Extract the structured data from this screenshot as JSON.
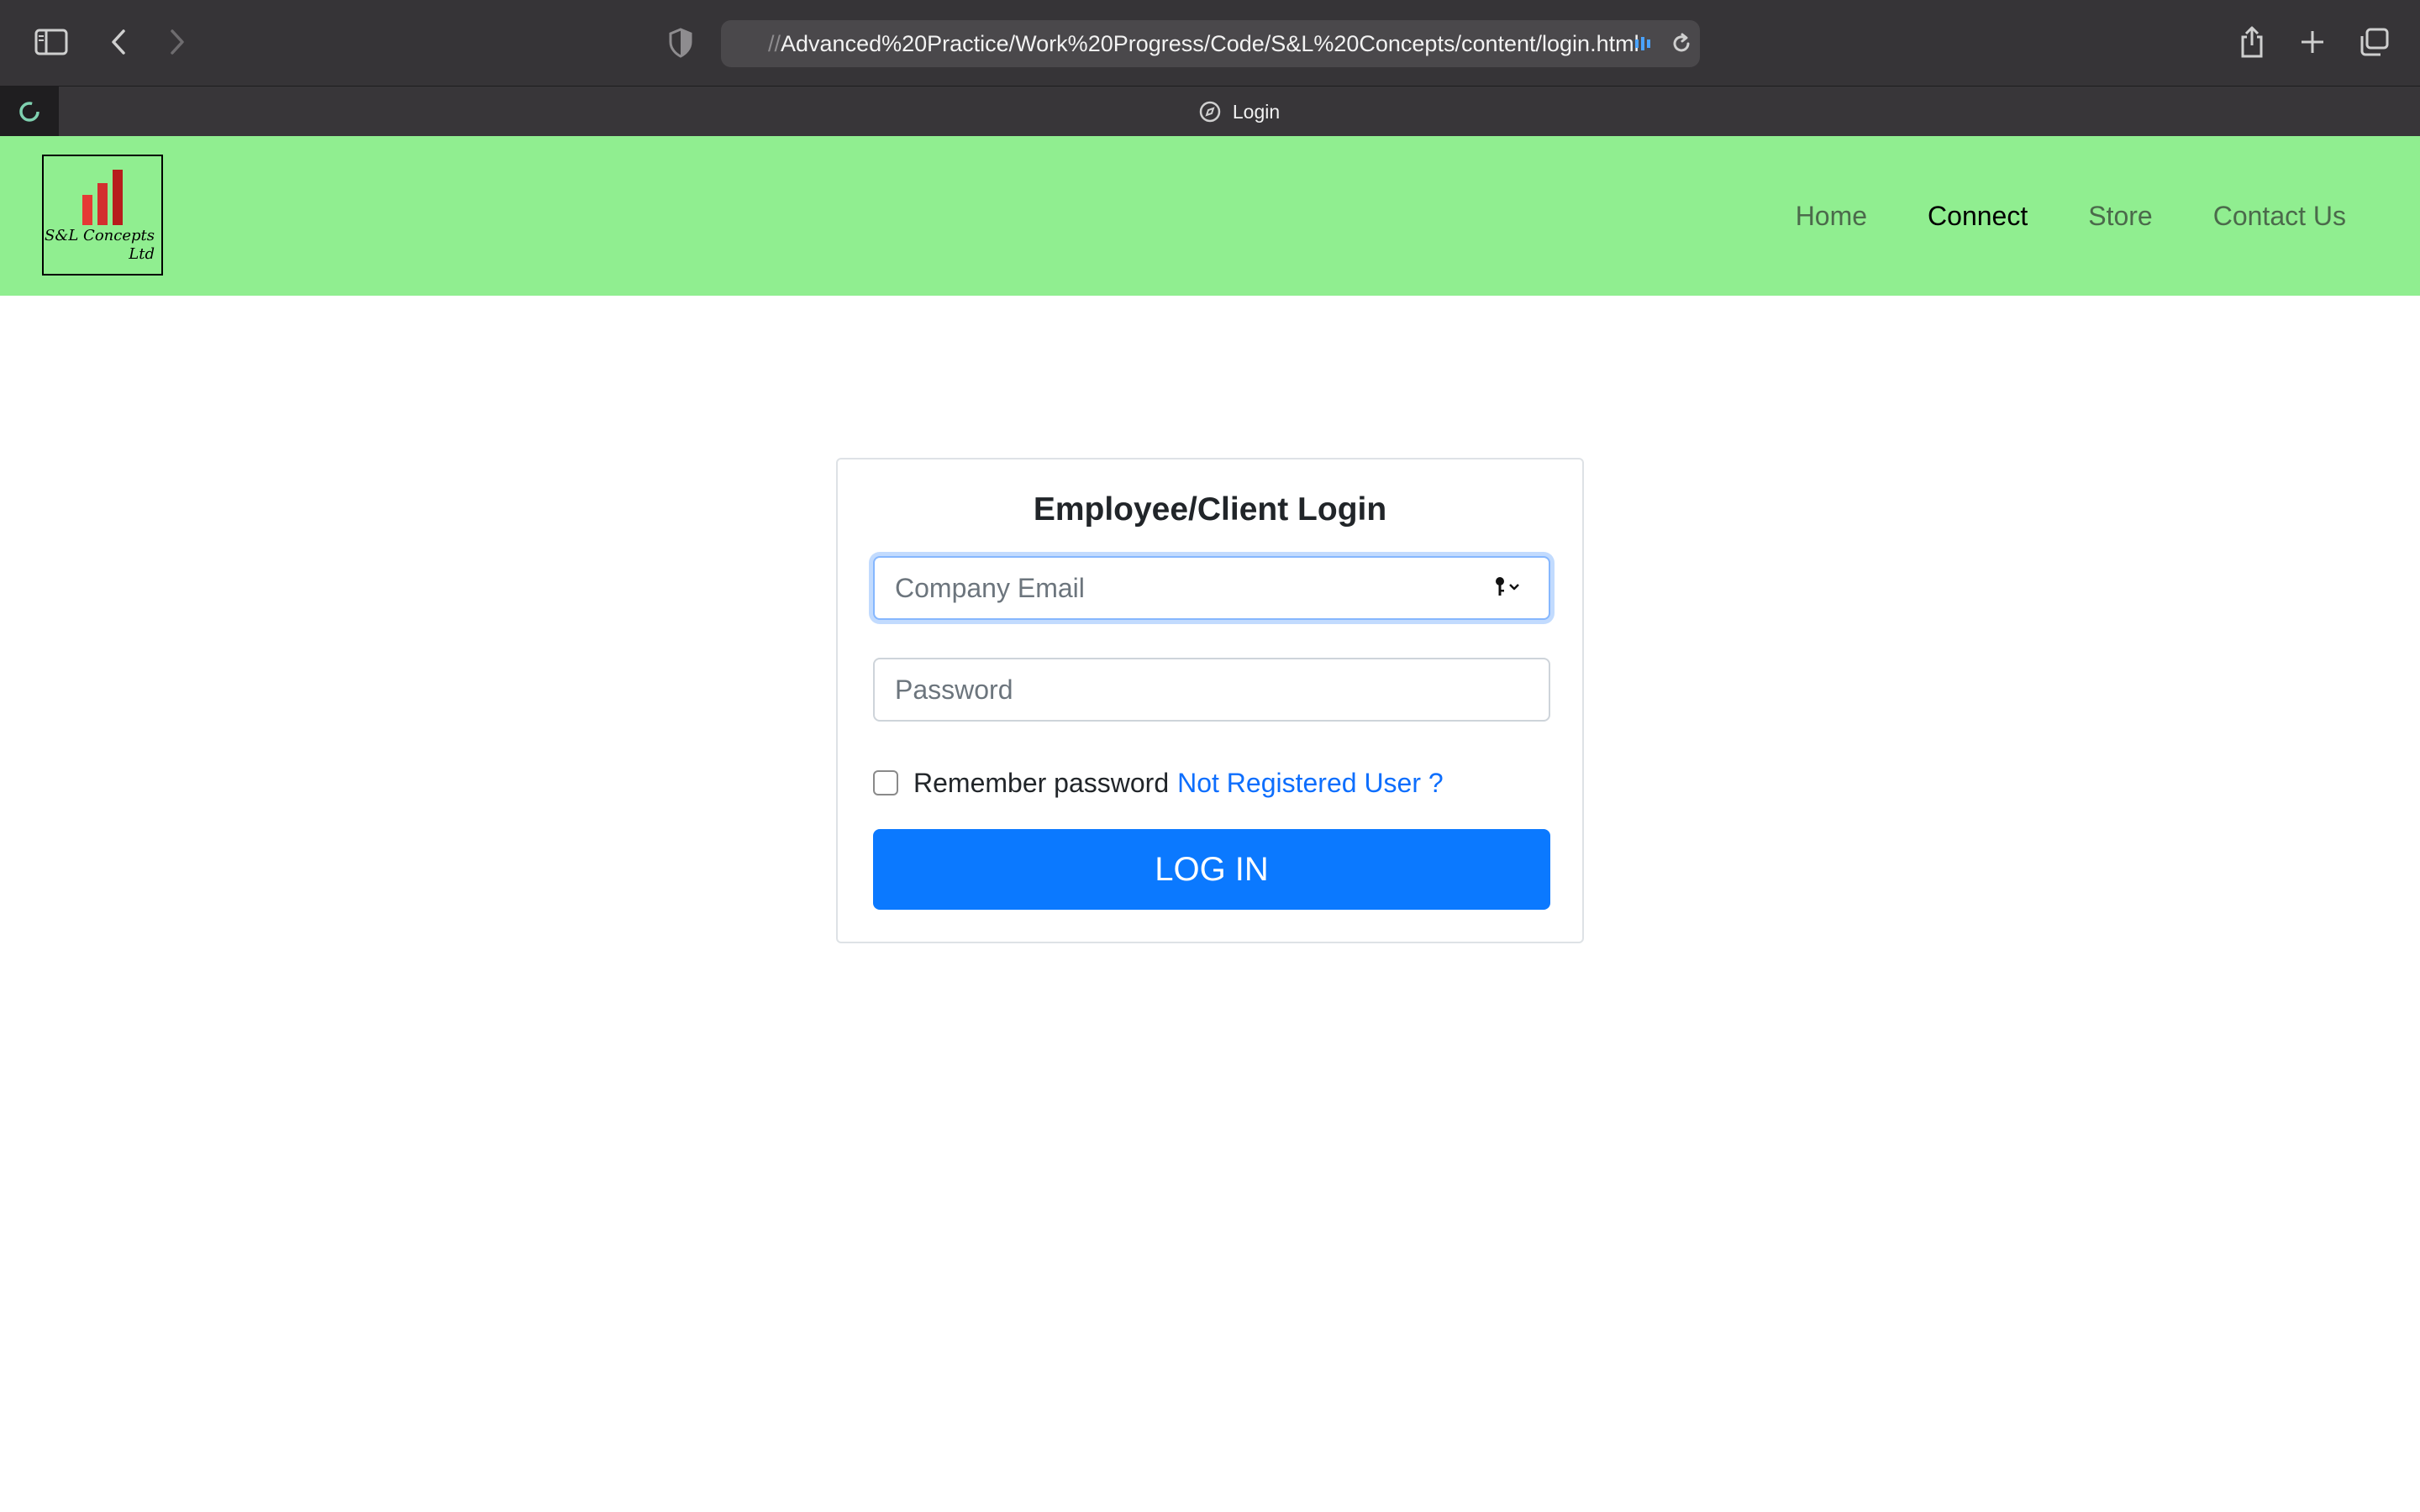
{
  "browser": {
    "url_prefix": "//",
    "url": "Advanced%20Practice/Work%20Progress/Code/S&L%20Concepts/content/login.html",
    "tab_title": "Login",
    "icons": {
      "sidebar": "sidebar-icon",
      "back": "chevron-left-icon",
      "forward": "chevron-right-icon",
      "privacy": "shield-icon",
      "reload": "reload-icon",
      "share": "share-icon",
      "new_tab": "plus-icon",
      "tab_overview": "tabs-overview-icon"
    }
  },
  "site": {
    "logo_text_line1": "S&L Concepts",
    "logo_text_line2": "Ltd",
    "nav": [
      {
        "label": "Home",
        "active": false
      },
      {
        "label": "Connect",
        "active": true
      },
      {
        "label": "Store",
        "active": false
      },
      {
        "label": "Contact Us",
        "active": false
      }
    ],
    "colors": {
      "nav_bg": "#90ee90",
      "logo_bar_light": "#e53935",
      "logo_bar_dark": "#b71c1c"
    }
  },
  "login": {
    "title": "Employee/Client Login",
    "email_placeholder": "Company Email",
    "email_value": "",
    "password_placeholder": "Password",
    "password_value": "",
    "remember_label": "Remember password",
    "remember_checked": false,
    "register_link": "Not Registered User ?",
    "submit_label": "LOG IN",
    "colors": {
      "button": "#0b79ff",
      "link": "#0d6efd"
    }
  }
}
